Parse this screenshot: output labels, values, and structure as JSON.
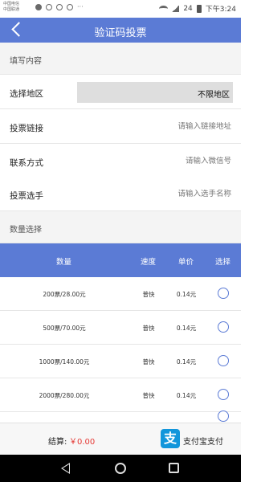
{
  "status_bar": {
    "carrier1": "中国电信",
    "carrier2": "中国联通",
    "battery_percent": "24",
    "time": "下午3:24"
  },
  "header": {
    "title": "验证码投票",
    "back_icon": "chevron-left-icon"
  },
  "form": {
    "section_title": "填写内容",
    "region": {
      "label": "选择地区",
      "value": "不限地区"
    },
    "vote_link": {
      "label": "投票链接",
      "placeholder": "请输入链接地址"
    },
    "contact": {
      "label": "联系方式",
      "placeholder": "请输入微信号"
    },
    "contestant": {
      "label": "投票选手",
      "placeholder": "请输入选手名称"
    }
  },
  "quantity_section": {
    "title": "数量选择",
    "columns": [
      "数量",
      "速度",
      "单价",
      "选择"
    ],
    "rows": [
      {
        "qty": "200票/28.00元",
        "speed": "普快",
        "price": "0.14元"
      },
      {
        "qty": "500票/70.00元",
        "speed": "普快",
        "price": "0.14元"
      },
      {
        "qty": "1000票/140.00元",
        "speed": "普快",
        "price": "0.14元"
      },
      {
        "qty": "2000票/280.00元",
        "speed": "普快",
        "price": "0.14元"
      }
    ]
  },
  "footer": {
    "total_label": "结算:",
    "total_value": "￥0.00",
    "pay_label": "支付宝支付",
    "pay_logo_text": "支",
    "pay_icon": "alipay-icon"
  },
  "colors": {
    "accent": "#5b7bd5",
    "price_red": "#e53935",
    "alipay_blue": "#1296db"
  }
}
